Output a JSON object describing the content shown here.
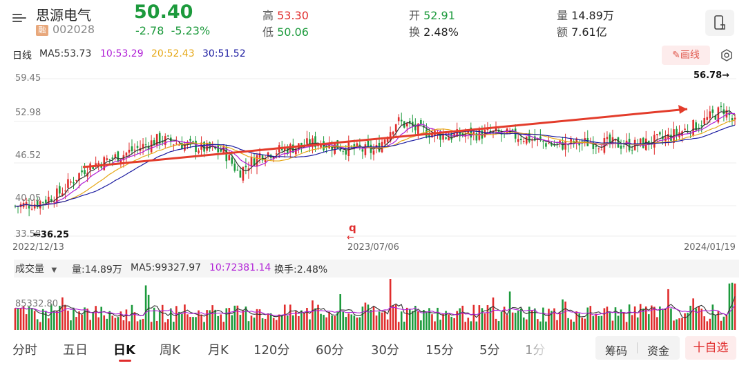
{
  "header": {
    "stock_name": "思源电气",
    "rong_badge": "融",
    "stock_code": "002028",
    "price": "50.40",
    "change": "-2.78",
    "change_pct": "-5.23%",
    "high_label": "高",
    "high_value": "53.30",
    "low_label": "低",
    "low_value": "50.06",
    "open_label": "开",
    "open_value": "52.91",
    "turnover_label": "换",
    "turnover_value": "2.48%",
    "volume_label": "量",
    "volume_value": "14.89万",
    "amount_label": "额",
    "amount_value": "7.61亿"
  },
  "ma_row": {
    "period": "日线",
    "ma5": "MA5:53.73",
    "ma10": "10:53.29",
    "ma20": "20:52.43",
    "ma30": "30:51.52",
    "draw_button": "画线"
  },
  "kline": {
    "y_labels": [
      "59.45",
      "52.98",
      "46.52",
      "40.05",
      "33.58"
    ],
    "x_labels": [
      "2022/12/13",
      "2023/07/06",
      "2024/01/19"
    ],
    "high_marker": "56.78→",
    "low_marker": "←36.25",
    "marker_q": "q"
  },
  "volume": {
    "selector": "成交量",
    "vol": "量:14.89万",
    "ma5": "MA5:99327.97",
    "ma10": "10:72381.14",
    "turnover": "换手:2.48%",
    "axis_label": "85332.80"
  },
  "tabs": [
    "分时",
    "五日",
    "日K",
    "周K",
    "月K",
    "120分",
    "60分",
    "30分",
    "15分",
    "5分",
    "1分"
  ],
  "active_tab": "日K",
  "buttons": {
    "chouma": "筹码",
    "zijin": "资金",
    "add_fav": "十自选"
  },
  "colors": {
    "up": "#e02c2c",
    "down": "#1c9a3c",
    "ma5": "#333333",
    "ma10": "#b01fd6",
    "ma20": "#e6a817",
    "ma30": "#1a1aa0"
  }
}
